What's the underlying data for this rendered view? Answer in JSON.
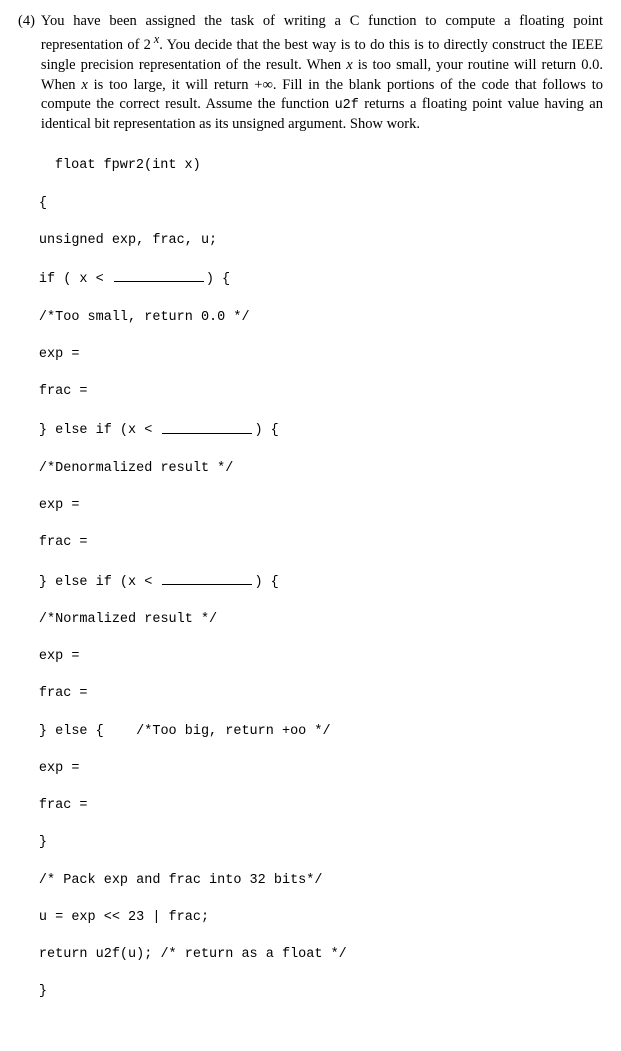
{
  "problem": {
    "number": "(4)",
    "text_pre": "You have been assigned the task of writing a C function to compute a floating point representation of 2",
    "sup": "x",
    "text_mid1": ". You decide that the best way is to do this is to directly construct the IEEE single precision representation of the result. When ",
    "var1": "x",
    "text_mid2": " is too small, your routine will return 0.0. When ",
    "var2": "x",
    "text_mid3": " is too large, it will return +∞. Fill in the blank portions of the code that follows to compute the correct result. Assume the function ",
    "u2f": "u2f",
    "text_end": " returns a floating point value having an identical bit representation as its unsigned argument. Show work."
  },
  "code": {
    "sig": "float fpwr2(int x)",
    "open": "{",
    "decl": "unsigned exp, frac, u;",
    "if1a": "if ( x < ",
    "if1b": ") {",
    "c1": "/*Too small, return 0.0 */",
    "exp": "exp =",
    "frac": "frac =",
    "elif1a": "} else if (x < ",
    "elif1b": ") {",
    "c2": "/*Denormalized result */",
    "elif2a": "} else if (x < ",
    "elif2b": ") {",
    "c3": "/*Normalized result */",
    "else": "} else {    /*Too big, return +oo */",
    "closeb": "}",
    "c4": "/* Pack exp and frac into 32 bits*/",
    "pack": "u = exp << 23 | frac;",
    "ret": "return u2f(u); /* return as a float */",
    "close": "}"
  }
}
